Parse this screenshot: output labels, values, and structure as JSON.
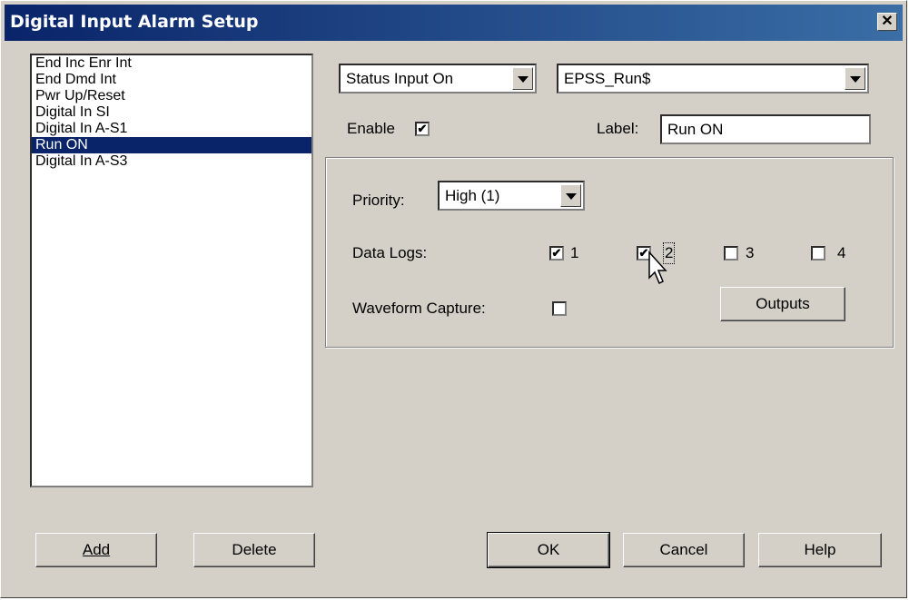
{
  "window": {
    "title": "Digital Input Alarm Setup",
    "close_glyph": "✕"
  },
  "alarm_list": {
    "items": [
      "End Inc Enr Int",
      "End Dmd Int",
      "Pwr Up/Reset",
      "Digital In SI",
      "Digital In A-S1",
      "Run ON",
      "Digital In A-S3"
    ],
    "selected_index": 5
  },
  "condition_combo": {
    "value": "Status Input On"
  },
  "source_combo": {
    "value": "EPSS_Run$"
  },
  "enable": {
    "label": "Enable",
    "checked": true
  },
  "label_field": {
    "label": "Label:",
    "value": "Run ON"
  },
  "priority": {
    "label": "Priority:",
    "value": "High (1)"
  },
  "data_logs": {
    "label": "Data Logs:",
    "options": [
      {
        "label": "1",
        "checked": true
      },
      {
        "label": "2",
        "checked": true
      },
      {
        "label": "3",
        "checked": false
      },
      {
        "label": "4",
        "checked": false
      }
    ]
  },
  "waveform": {
    "label": "Waveform Capture:",
    "checked": false
  },
  "buttons": {
    "outputs": "Outputs",
    "add": "Add",
    "delete": "Delete",
    "ok": "OK",
    "cancel": "Cancel",
    "help": "Help"
  },
  "check_glyph": "✔"
}
